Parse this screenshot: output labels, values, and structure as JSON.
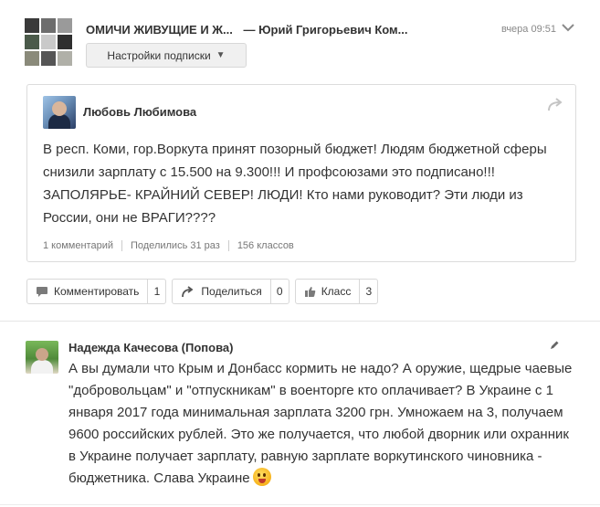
{
  "header": {
    "group_name": "ОМИЧИ ЖИВУЩИЕ И Ж...",
    "author": "— Юрий Григорьевич Ком...",
    "time": "вчера 09:51",
    "subscription_button": "Настройки подписки",
    "group_avatar_colors": [
      "#3a3a3a",
      "#6d6d6d",
      "#9a9a9a",
      "#4b5a4a",
      "#c9c9c9",
      "#2f2f2f",
      "#8a8a7a",
      "#555555",
      "#b0b0a8"
    ]
  },
  "post": {
    "author": "Любовь Любимова",
    "text": "В респ. Коми, гор.Воркута принят позорный бюджет! Людям бюджетной сферы снизили зарплату с 15.500 на 9.300!!! И профсоюзами это подписано!!! ЗАПОЛЯРЬЕ- КРАЙНИЙ СЕВЕР! ЛЮДИ! Кто нами руководит? Эти люди из России, они не ВРАГИ????",
    "stats": {
      "comments": "1 комментарий",
      "shares": "Поделились 31 раз",
      "likes": "156 классов"
    }
  },
  "actions": {
    "comment": {
      "label": "Комментировать",
      "count": "1"
    },
    "share": {
      "label": "Поделиться",
      "count": "0"
    },
    "like": {
      "label": "Класс",
      "count": "3"
    }
  },
  "comment": {
    "author": "Надежда Качесова (Попова)",
    "text": "А вы думали что Крым и Донбасс кормить не надо? А оружие, щедрые чаевые \"добровольцам\" и \"отпускникам\"  в военторге кто оплачивает?  В Украине с 1 января 2017 года минимальная зарплата 3200 грн. Умножаем на 3, получаем 9600 российских рублей. Это же получается, что любой дворник или охранник в Украине получает зарплату, равную зарплате воркутинского чиновника - бюджетника. Слава Украине",
    "emoji": "laughing-emoji"
  }
}
